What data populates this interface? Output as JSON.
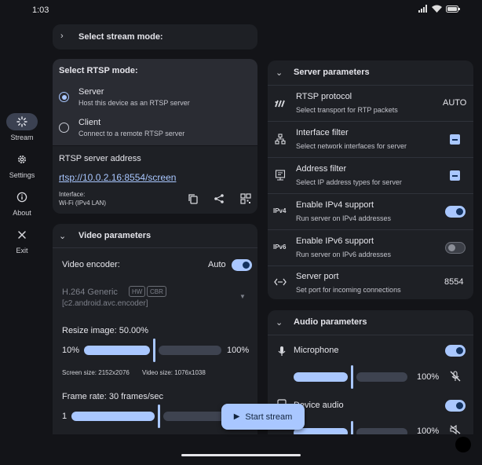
{
  "status": {
    "time": "1:03"
  },
  "rail": {
    "items": [
      {
        "label": "Stream"
      },
      {
        "label": "Settings"
      },
      {
        "label": "About"
      },
      {
        "label": "Exit"
      }
    ]
  },
  "stream_mode": {
    "title": "Select stream mode:"
  },
  "rtsp_mode": {
    "title": "Select RTSP mode:",
    "options": [
      {
        "label": "Server",
        "desc": "Host this device as an RTSP server"
      },
      {
        "label": "Client",
        "desc": "Connect to a remote RTSP server"
      }
    ]
  },
  "server_address": {
    "title": "RTSP server address",
    "url": "rtsp://10.0.2.16:8554/screen",
    "interface_label": "Interface:",
    "interface_value": "Wi-Fi (IPv4 LAN)"
  },
  "video": {
    "title": "Video parameters",
    "encoder_label": "Video encoder:",
    "encoder_mode": "Auto",
    "codec_name": "H.264 Generic",
    "badge_hw": "HW",
    "badge_cbr": "CBR",
    "codec_id": "[c2.android.avc.encoder]",
    "resize_label": "Resize image: 50.00%",
    "resize_min": "10%",
    "resize_max": "100%",
    "resize_value": 0.5,
    "screen_size": "Screen size: 2152x2076",
    "video_size": "Video size: 1076x1038",
    "frame_label": "Frame rate: 30 frames/sec",
    "frame_min": "1",
    "frame_value": 0.5
  },
  "server_params": {
    "title": "Server parameters",
    "rows": [
      {
        "title": "RTSP protocol",
        "desc": "Select transport for RTP packets",
        "value": "AUTO"
      },
      {
        "title": "Interface filter",
        "desc": "Select network interfaces for server"
      },
      {
        "title": "Address filter",
        "desc": "Select IP address types for server"
      },
      {
        "title": "Enable IPv4 support",
        "desc": "Run server on IPv4 addresses",
        "icon_text": "IPv4",
        "enabled": true
      },
      {
        "title": "Enable IPv6 support",
        "desc": "Run server on IPv6 addresses",
        "icon_text": "IPv6",
        "enabled": false
      },
      {
        "title": "Server port",
        "desc": "Set port for incoming connections",
        "value": "8554"
      }
    ]
  },
  "audio": {
    "title": "Audio parameters",
    "microphone": {
      "label": "Microphone",
      "volume_text": "100%",
      "enabled": true,
      "level": 1.0
    },
    "device_audio": {
      "label": "Device audio",
      "volume_text": "100%",
      "enabled": true,
      "level": 1.0
    }
  },
  "fab": {
    "label": "Start stream"
  },
  "colors": {
    "accent": "#a9c7ff",
    "surface": "#1e2025",
    "background": "#131418"
  }
}
